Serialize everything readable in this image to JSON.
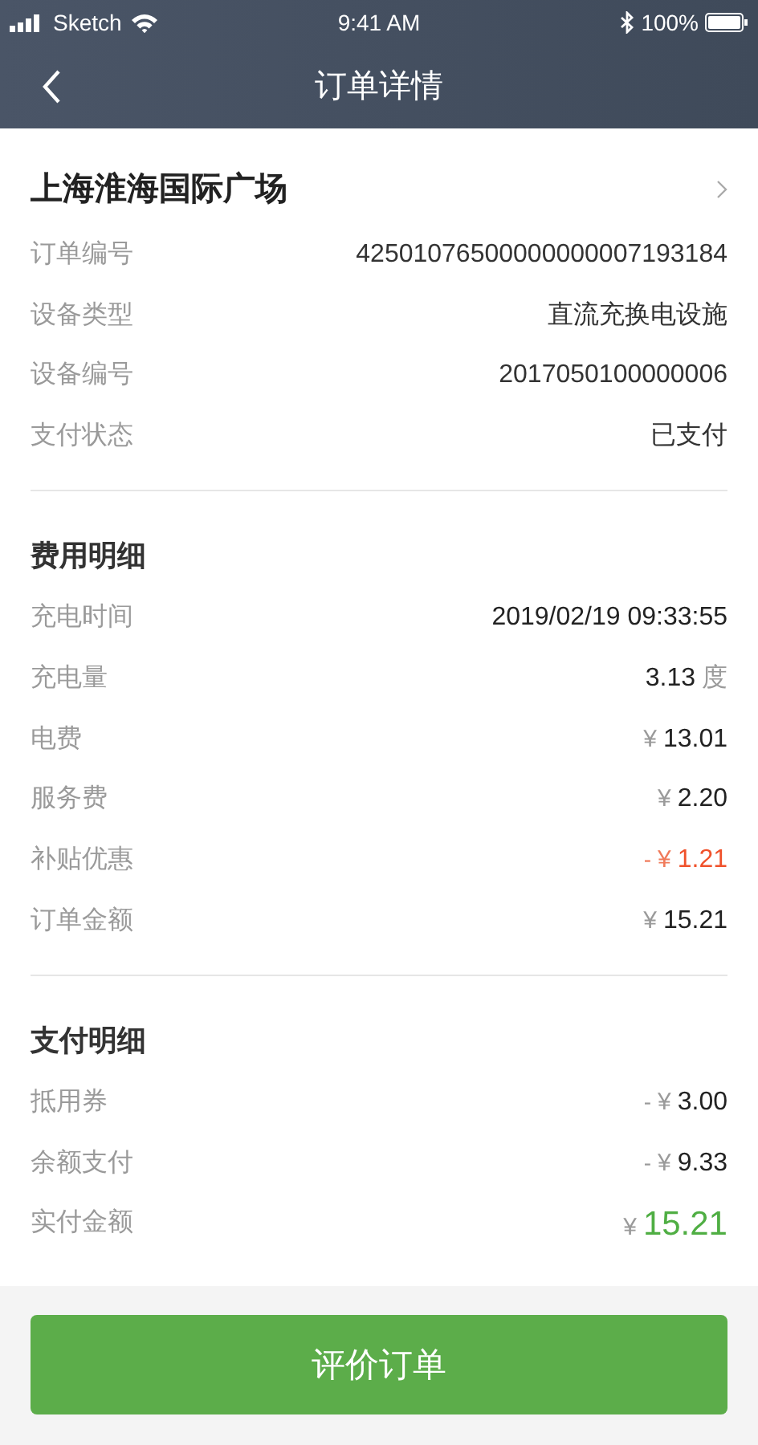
{
  "status_bar": {
    "carrier": "Sketch",
    "time": "9:41 AM",
    "battery": "100%"
  },
  "nav": {
    "title": "订单详情"
  },
  "station": {
    "name": "上海淮海国际广场"
  },
  "info_rows": [
    {
      "label": "订单编号",
      "value": "42501076500000000007193184"
    },
    {
      "label": "设备类型",
      "value": "直流充换电设施"
    },
    {
      "label": "设备编号",
      "value": "2017050100000006"
    },
    {
      "label": "支付状态",
      "value": "已支付"
    }
  ],
  "sections": [
    {
      "title": "费用明细",
      "rows": [
        {
          "label": "充电时间",
          "kind": "plain",
          "amount": "2019/02/19 09:33:55"
        },
        {
          "label": "充电量",
          "kind": "plain",
          "amount": "3.13",
          "unit": "度"
        },
        {
          "label": "电费",
          "kind": "plain",
          "currency": "¥",
          "amount": "13.01"
        },
        {
          "label": "服务费",
          "kind": "plain",
          "currency": "¥",
          "amount": "2.20"
        },
        {
          "label": "补贴优惠",
          "kind": "discount",
          "sign": "-",
          "currency": "¥",
          "amount": "1.21"
        },
        {
          "label": "订单金额",
          "kind": "plain",
          "currency": "¥",
          "amount": "15.21"
        }
      ]
    },
    {
      "title": "支付明细",
      "rows": [
        {
          "label": "抵用券",
          "kind": "plain",
          "sign": "-",
          "currency": "¥",
          "amount": "3.00"
        },
        {
          "label": "余额支付",
          "kind": "plain",
          "sign": "-",
          "currency": "¥",
          "amount": "9.33"
        },
        {
          "label": "实付金额",
          "kind": "total",
          "currency": "¥",
          "amount": "15.21"
        }
      ]
    }
  ],
  "button": {
    "label": "评价订单"
  }
}
